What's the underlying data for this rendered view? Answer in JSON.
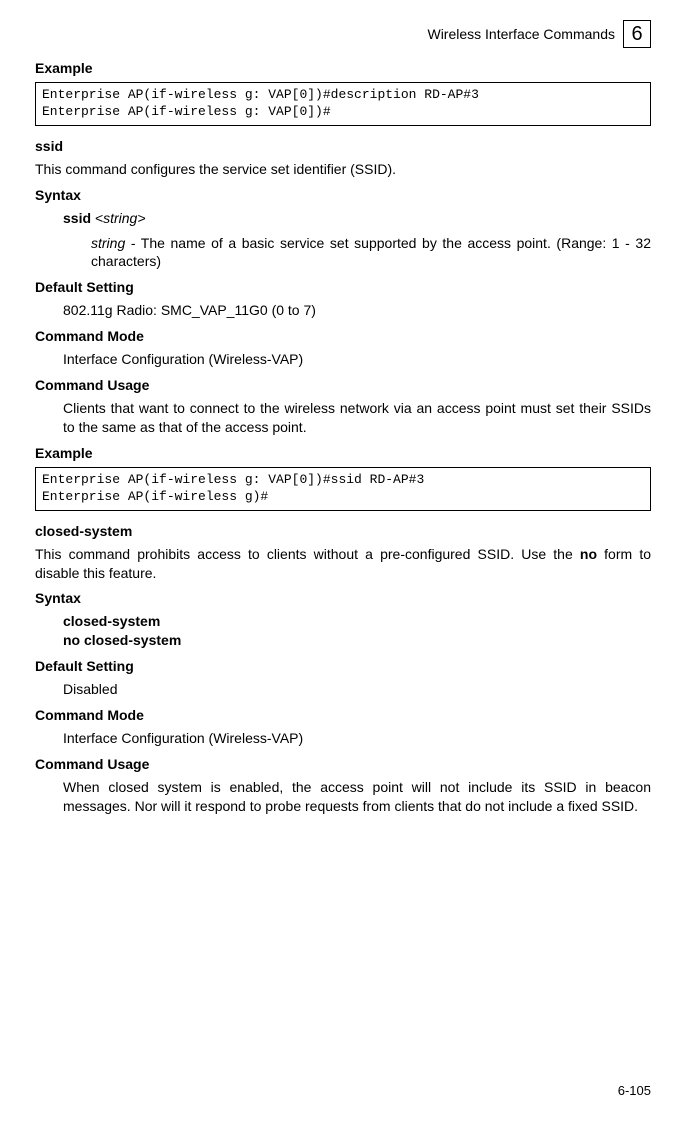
{
  "header": {
    "title": "Wireless Interface Commands",
    "chapter": "6"
  },
  "sec1": {
    "example_label": "Example",
    "code": "Enterprise AP(if-wireless g: VAP[0])#description RD-AP#3\nEnterprise AP(if-wireless g: VAP[0])#"
  },
  "ssid": {
    "title": "ssid",
    "desc": "This command configures the service set identifier (SSID).",
    "syntax_label": "Syntax",
    "syntax_cmd": "ssid",
    "syntax_arg": " <string>",
    "param_name": "string",
    "param_desc": " - The name of a basic service set supported by the access point. (Range: 1 - 32 characters)",
    "default_label": "Default Setting",
    "default_value": "802.11g Radio: SMC_VAP_11G0 (0 to 7)",
    "mode_label": "Command Mode",
    "mode_value": "Interface Configuration (Wireless-VAP)",
    "usage_label": "Command Usage",
    "usage_value": "Clients that want to connect to the wireless network via an access point must set their SSIDs to the same as that of the access point.",
    "example_label": "Example",
    "code": "Enterprise AP(if-wireless g: VAP[0])#ssid RD-AP#3\nEnterprise AP(if-wireless g)#"
  },
  "closed": {
    "title": "closed-system",
    "desc_pre": "This command prohibits access to clients without a pre-configured SSID. Use the ",
    "desc_bold": "no",
    "desc_post": " form to disable this feature.",
    "syntax_label": "Syntax",
    "syntax_line1": "closed-system",
    "syntax_line2": "no closed-system",
    "default_label": "Default Setting",
    "default_value": "Disabled",
    "mode_label": "Command Mode",
    "mode_value": "Interface Configuration (Wireless-VAP)",
    "usage_label": "Command Usage",
    "usage_value": "When closed system is enabled, the access point will not include its SSID in beacon messages. Nor will it respond to probe requests from clients that do not include a fixed SSID."
  },
  "page_number": "6-105"
}
